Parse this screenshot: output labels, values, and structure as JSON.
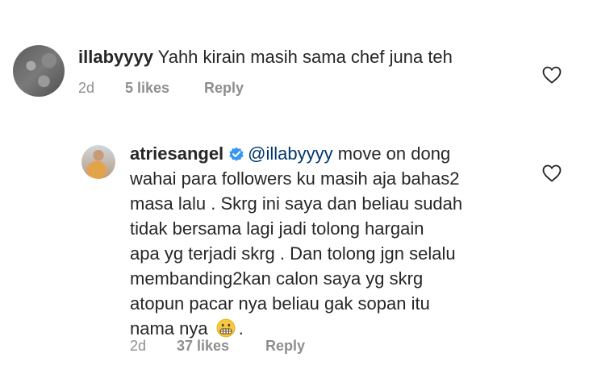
{
  "comment1": {
    "username": "illabyyyy",
    "text": "Yahh kirain masih sama chef juna teh",
    "time": "2d",
    "likes": "5 likes",
    "reply_label": "Reply"
  },
  "comment2": {
    "username": "atriesangel",
    "mention": "@illabyyyy",
    "line1_rest": "move on dong",
    "lines": [
      "wahai para followers ku masih aja bahas2",
      "masa lalu . Skrg ini saya dan beliau sudah",
      "tidak bersama lagi jadi tolong hargain",
      "apa yg terjadi skrg . Dan tolong jgn selalu",
      "membanding2kan calon saya yg skrg",
      "atopun pacar nya beliau gak sopan itu"
    ],
    "last_line_text": "nama nya",
    "last_line_end": ".",
    "time": "2d",
    "likes": "37 likes",
    "reply_label": "Reply"
  },
  "icons": {
    "like": "heart-outline-icon",
    "verified": "verified-badge-icon",
    "emoji": "grimacing-face-emoji"
  },
  "colors": {
    "text": "#262626",
    "meta": "#8e8e8e",
    "mention": "#00376b",
    "verified": "#3897f0"
  }
}
